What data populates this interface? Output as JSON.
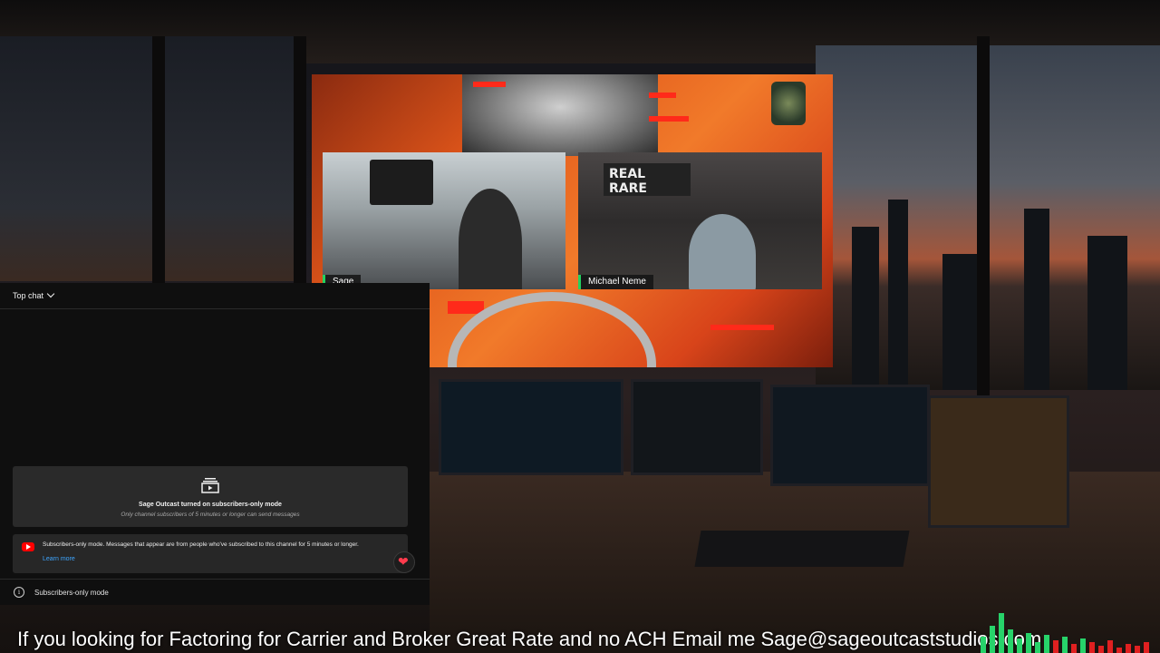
{
  "stream": {
    "participants": [
      {
        "name": "Sage"
      },
      {
        "name": "Michael Neme"
      }
    ],
    "sign_text": "REAL RARE"
  },
  "chat": {
    "title": "Top chat",
    "mode_card": {
      "icon": "subscribers-only-icon",
      "title": "Sage Outcast turned on subscribers-only mode",
      "subtitle": "Only channel subscribers of 5 minutes or longer can send messages"
    },
    "notice": {
      "icon": "youtube-icon",
      "text": "Subscribers-only mode. Messages that appear are from people who've subscribed to this channel for 5 minutes or longer.",
      "link": "Learn more"
    },
    "reaction_icon": "heart-icon",
    "footer": {
      "icon": "info-icon",
      "text": "Subscribers-only mode"
    }
  },
  "ticker": "If you looking for Factoring for Carrier and Broker Great Rate and no ACH Email me Sage@sageoutcaststudios.com",
  "colors": {
    "accent_green": "#23d160",
    "link_blue": "#3ea6ff",
    "youtube_red": "#ff0000",
    "stream_orange": "#f17a2a"
  }
}
